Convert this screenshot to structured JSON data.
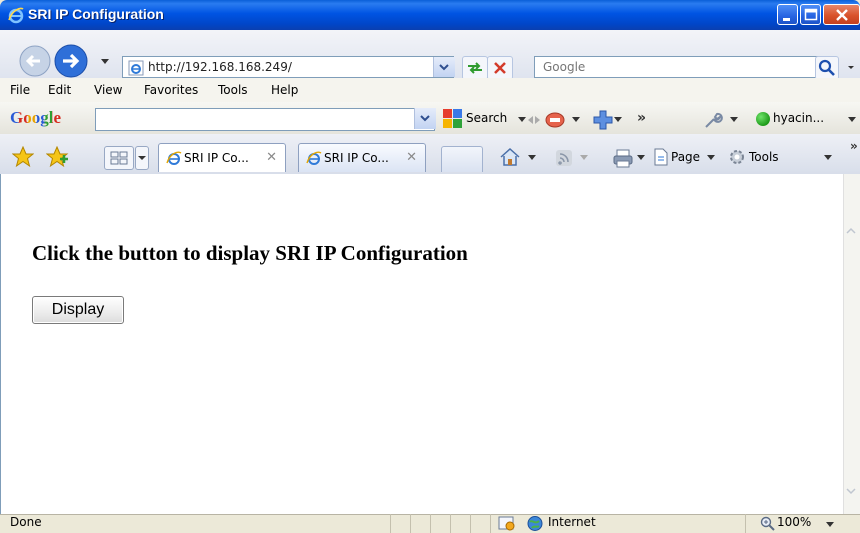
{
  "window": {
    "title": "SRI IP Configuration"
  },
  "address_bar": {
    "url": "http://192.168.168.249/",
    "search_placeholder": "Google"
  },
  "menu": {
    "items": [
      "File",
      "Edit",
      "View",
      "Favorites",
      "Tools",
      "Help"
    ]
  },
  "google_toolbar": {
    "logo": "Google",
    "search_label": "Search",
    "more": "»",
    "user_label": "hyacin..."
  },
  "tabs": {
    "items": [
      {
        "label": "SRI IP Co...",
        "close": "✕"
      },
      {
        "label": "SRI IP Co...",
        "close": "✕"
      }
    ]
  },
  "command_bar": {
    "page_label": "Page",
    "tools_label": "Tools",
    "more": "»"
  },
  "content": {
    "heading": "Click the button to display SRI IP Configuration",
    "button_label": "Display"
  },
  "status_bar": {
    "status_text": "Done",
    "zone_label": "Internet",
    "zoom_label": "100%"
  },
  "colors": {
    "title_bar": "#0054e3",
    "close_button": "#d9532b",
    "chrome": "#ece9d8"
  }
}
